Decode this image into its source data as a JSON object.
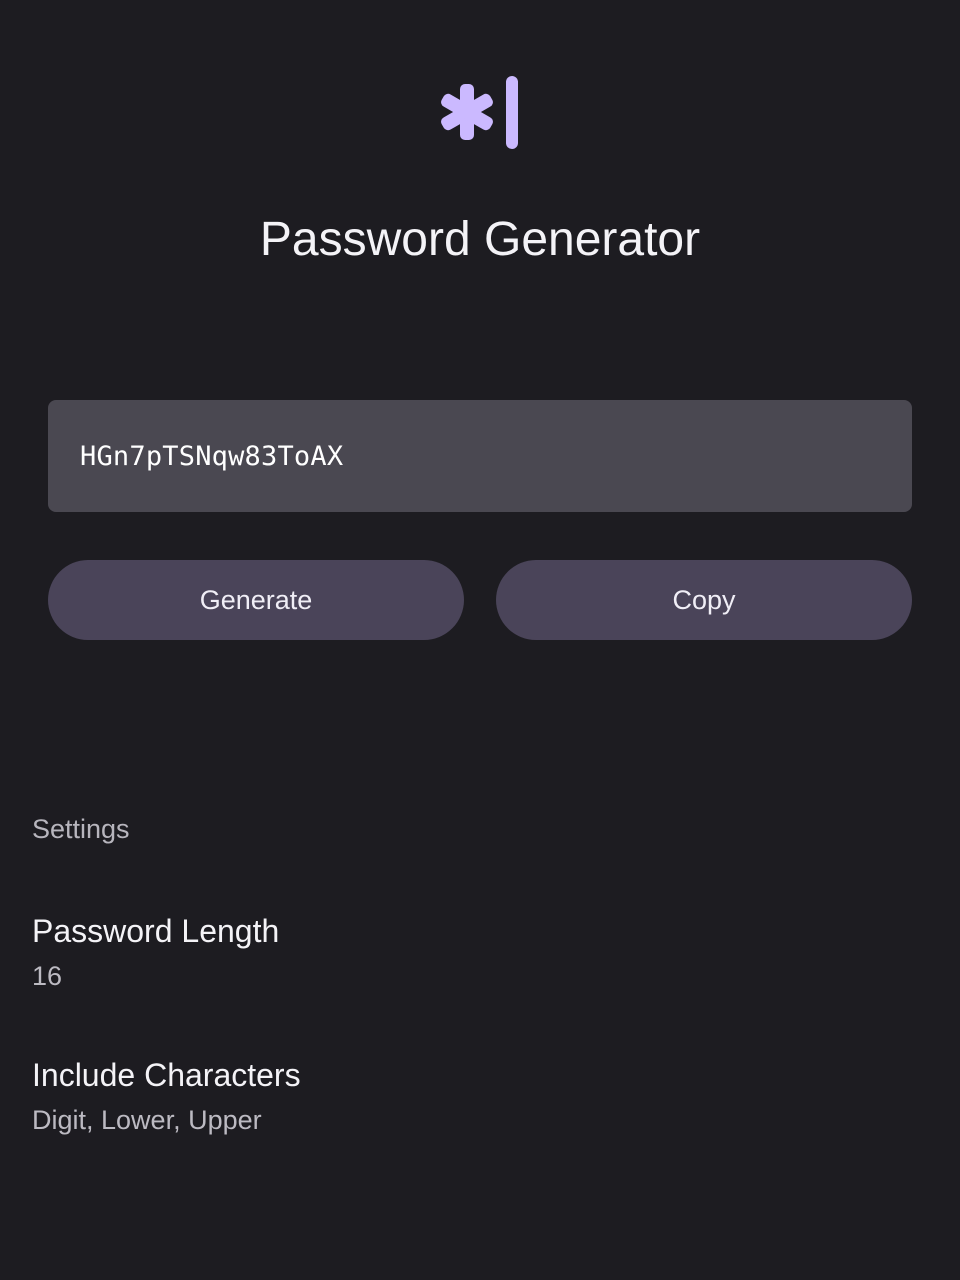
{
  "app": {
    "title": "Password Generator",
    "logo_icon": "asterisk-cursor-icon",
    "accent_color": "#cbb9ff"
  },
  "password": {
    "value": "HGn7pTSNqw83ToAX"
  },
  "actions": {
    "generate_label": "Generate",
    "copy_label": "Copy"
  },
  "settings": {
    "header": "Settings",
    "length": {
      "label": "Password Length",
      "value": "16"
    },
    "characters": {
      "label": "Include Characters",
      "value": "Digit, Lower, Upper"
    }
  }
}
